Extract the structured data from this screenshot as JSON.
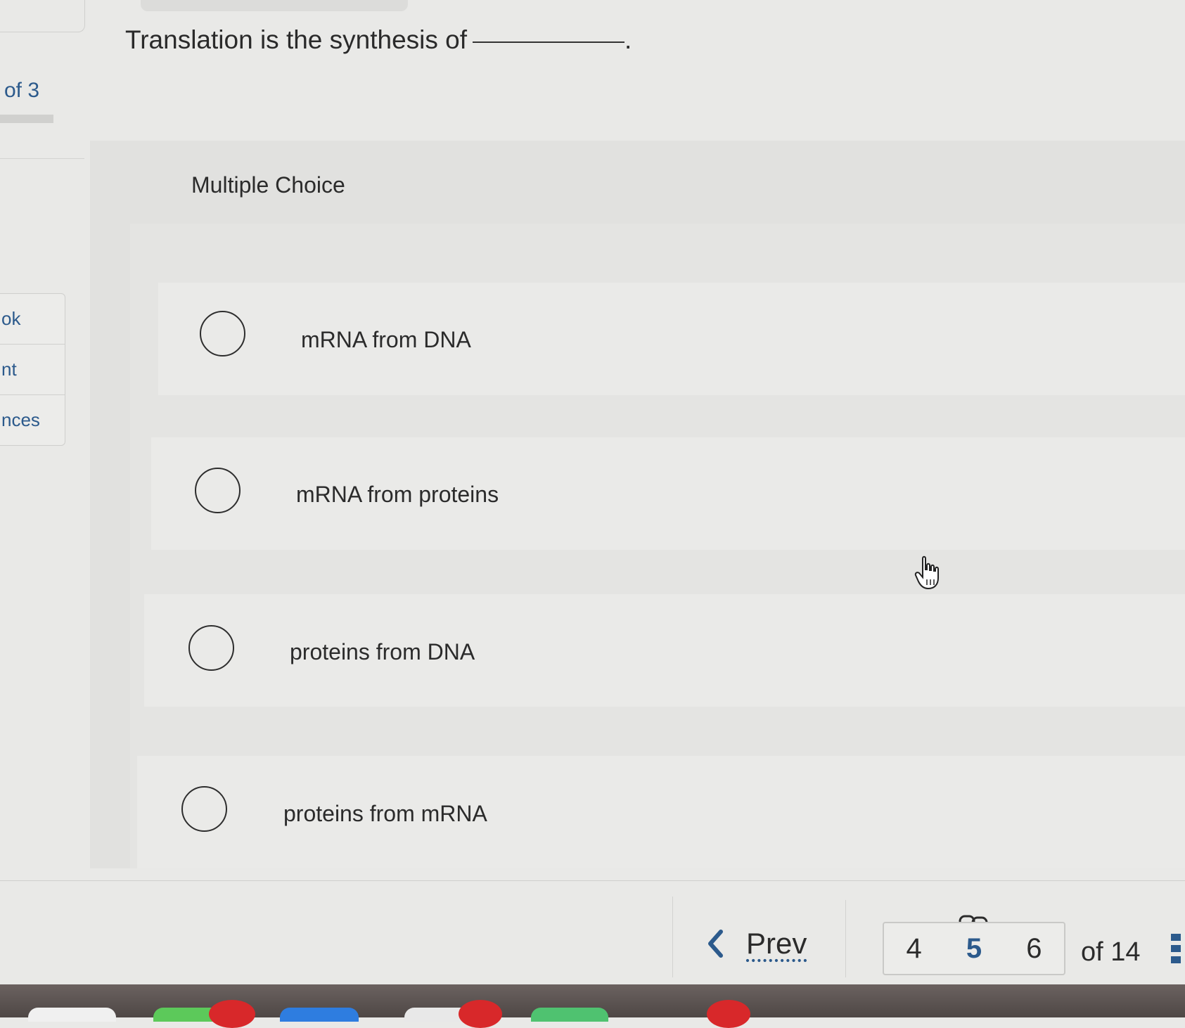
{
  "left_panel": {
    "progress_text": "of 3",
    "tabs": [
      {
        "label": "ok"
      },
      {
        "label": "nt"
      },
      {
        "label": "nces"
      }
    ]
  },
  "question": {
    "text": "Translation is the synthesis of",
    "end_punct": "."
  },
  "question_type": "Multiple Choice",
  "choices": [
    {
      "label": "mRNA from DNA",
      "selected": false
    },
    {
      "label": "mRNA from proteins",
      "selected": false
    },
    {
      "label": "proteins from DNA",
      "selected": false
    },
    {
      "label": "proteins from mRNA",
      "selected": false
    }
  ],
  "footer": {
    "prev_label": "Prev",
    "pages": [
      "4",
      "5",
      "6"
    ],
    "current_page": "5",
    "of_total": "of 14"
  },
  "colors": {
    "accent": "#2c5a8c",
    "background": "#e9e9e7",
    "text": "#2b2b2b",
    "badge": "#d8282a"
  },
  "icons": [
    "chevron-left-icon",
    "link-icon",
    "hand-cursor-icon",
    "menu-icon",
    "radio-icon"
  ]
}
